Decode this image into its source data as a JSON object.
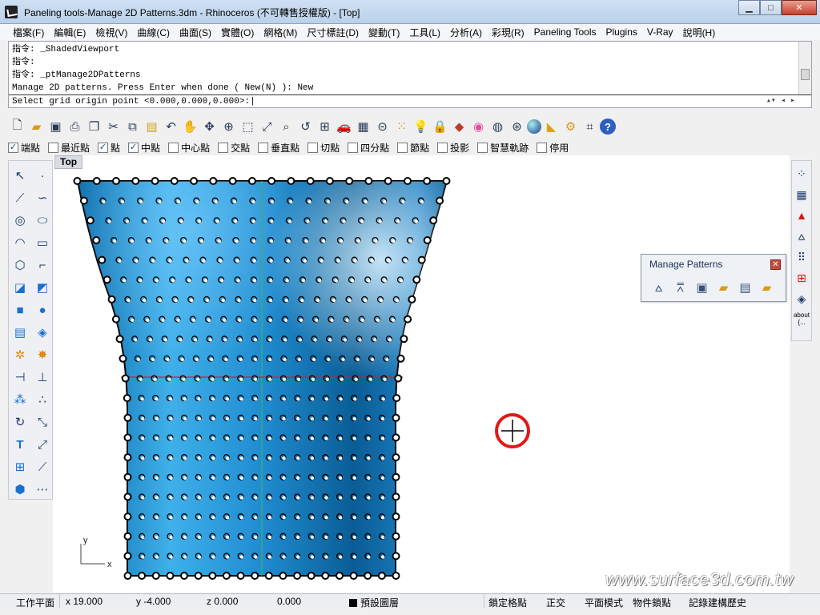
{
  "window": {
    "title": "Paneling tools-Manage 2D Patterns.3dm - Rhinoceros (不可轉售授權版) - [Top]"
  },
  "menu": [
    "檔案(F)",
    "編輯(E)",
    "檢視(V)",
    "曲線(C)",
    "曲面(S)",
    "實體(O)",
    "網格(M)",
    "尺寸標註(D)",
    "變動(T)",
    "工具(L)",
    "分析(A)",
    "彩現(R)",
    "Paneling Tools",
    "Plugins",
    "V-Ray",
    "說明(H)"
  ],
  "command": {
    "history": [
      "指令: _ShadedViewport",
      "指令:",
      "指令: _ptManage2DPatterns",
      "Manage 2D patterns. Press Enter when done ( New(N) ): New"
    ],
    "prompt": "Select grid origin point <0.000,0.000,0.000>:"
  },
  "toolbar_icons": [
    "new-file-icon",
    "open-file-icon",
    "save-icon",
    "print-icon",
    "import-icon",
    "cut-icon",
    "copy-icon",
    "paste-icon",
    "undo-icon",
    "pan-icon",
    "rotate-view-icon",
    "zoom-dynamic-icon",
    "zoom-window-icon",
    "zoom-extents-icon",
    "zoom-selected-icon",
    "undo-view-icon",
    "four-viewports-icon",
    "car-icon",
    "grid-icon",
    "section-icon",
    "points-icon",
    "light-icon",
    "lock-icon",
    "layer-icon",
    "color-wheel-icon",
    "wireframe-icon",
    "render-mesh-icon",
    "render-sphere-icon",
    "flashlight-icon",
    "options-gear-icon",
    "puzzle-icon",
    "help-icon"
  ],
  "osnaps": [
    {
      "label": "端點",
      "checked": true
    },
    {
      "label": "最近點",
      "checked": false
    },
    {
      "label": "點",
      "checked": true
    },
    {
      "label": "中點",
      "checked": true
    },
    {
      "label": "中心點",
      "checked": false
    },
    {
      "label": "交點",
      "checked": false
    },
    {
      "label": "垂直點",
      "checked": false
    },
    {
      "label": "切點",
      "checked": false
    },
    {
      "label": "四分點",
      "checked": false
    },
    {
      "label": "節點",
      "checked": false
    },
    {
      "label": "投影",
      "checked": false
    },
    {
      "label": "智慧軌跡",
      "checked": false
    },
    {
      "label": "停用",
      "checked": false
    }
  ],
  "viewport": {
    "name": "Top",
    "axis_x": "x",
    "axis_y": "y"
  },
  "manage_patterns": {
    "title": "Manage Patterns"
  },
  "right_panel": {
    "about_label": "about",
    "about_sub": "{..."
  },
  "status": {
    "plane": "工作平面",
    "x": "x 19.000",
    "y": "y -4.000",
    "z": "z 0.000",
    "dist": "0.000",
    "layer": "預設圖層",
    "snap": "鎖定格點",
    "ortho": "正交",
    "planar": "平面模式",
    "osnap": "物件鎖點",
    "history": "記錄建構歷史"
  },
  "watermark": "www.surface3d.com.tw",
  "colors": {
    "surface_light": "#4fb8ef",
    "surface_dark": "#0a5d95",
    "cursor_ring": "#e01818",
    "x_axis": "#d02020",
    "y_axis": "#3fb06a"
  }
}
